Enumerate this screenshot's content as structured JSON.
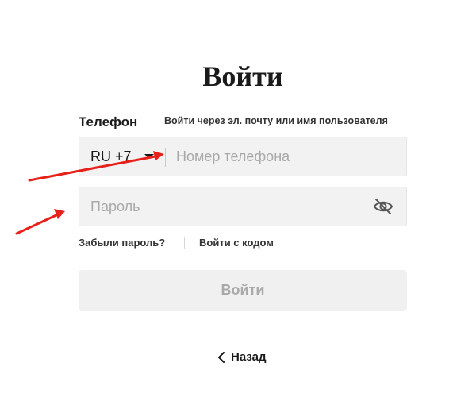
{
  "header": {
    "title": "Войти"
  },
  "phone": {
    "label": "Телефон",
    "alt_login_link": "Войти через эл. почту или имя пользователя",
    "country_code": "RU +7",
    "placeholder": "Номер телефона",
    "value": ""
  },
  "password": {
    "placeholder": "Пароль",
    "value": "",
    "visibility_icon": "eye-off-icon"
  },
  "links": {
    "forgot_password": "Забыли пароль?",
    "login_with_code": "Войти с кодом"
  },
  "submit": {
    "label": "Войти",
    "enabled": false
  },
  "back": {
    "label": "Назад",
    "icon": "chevron-left-icon"
  },
  "annotations": {
    "arrow_color": "#e8201a"
  }
}
